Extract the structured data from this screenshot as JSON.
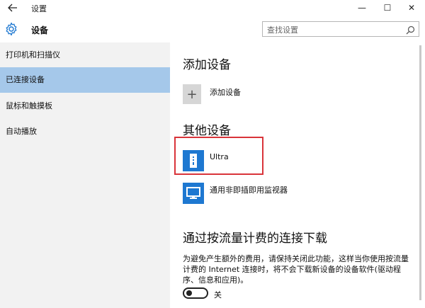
{
  "window": {
    "title": "设置",
    "controls": {
      "minimize": "—",
      "maximize": "☐",
      "close": "✕"
    }
  },
  "header": {
    "title": "设备",
    "search": {
      "placeholder": "查找设置",
      "value": ""
    }
  },
  "sidebar": {
    "items": [
      {
        "label": "打印机和扫描仪",
        "active": false
      },
      {
        "label": "已连接设备",
        "active": true
      },
      {
        "label": "鼠标和触摸板",
        "active": false
      },
      {
        "label": "自动播放",
        "active": false
      }
    ]
  },
  "main": {
    "add_section": {
      "title": "添加设备",
      "add_label": "添加设备"
    },
    "other_section": {
      "title": "其他设备",
      "devices": [
        {
          "name": "Ultra",
          "icon": "usb-drive-icon"
        },
        {
          "name": "通用非即插即用监视器",
          "icon": "monitor-icon"
        }
      ]
    },
    "metered_section": {
      "title": "通过按流量计费的连接下载",
      "description": "为避免产生额外的费用，请保持关闭此功能，这样当你使用按流量计费的 Internet 连接时，将不会下载新设备的设备软件(驱动程序、信息和应用)。",
      "toggle_state": "关"
    }
  },
  "colors": {
    "accent": "#1e78d1",
    "sidebar_bg": "#f2f2f2",
    "sidebar_active": "#a5c8ea",
    "highlight_border": "#d9343a"
  }
}
